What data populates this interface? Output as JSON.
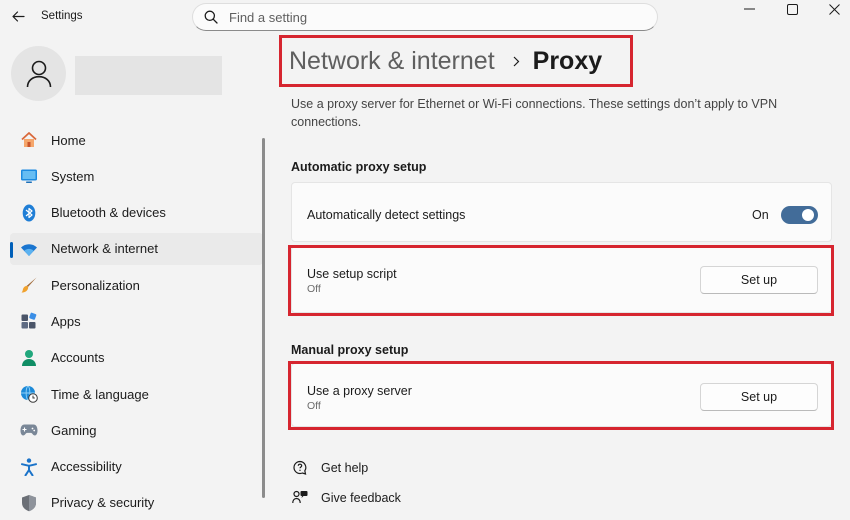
{
  "window": {
    "title": "Settings",
    "minimize_glyph": "—",
    "maximize_glyph": "☐",
    "close_glyph": "✕"
  },
  "search": {
    "placeholder": "Find a setting"
  },
  "sidebar": {
    "items": [
      {
        "label": "Home",
        "icon": "home-icon",
        "active": false
      },
      {
        "label": "System",
        "icon": "system-icon",
        "active": false
      },
      {
        "label": "Bluetooth & devices",
        "icon": "bluetooth-icon",
        "active": false
      },
      {
        "label": "Network & internet",
        "icon": "wifi-icon",
        "active": true
      },
      {
        "label": "Personalization",
        "icon": "brush-icon",
        "active": false
      },
      {
        "label": "Apps",
        "icon": "apps-icon",
        "active": false
      },
      {
        "label": "Accounts",
        "icon": "accounts-icon",
        "active": false
      },
      {
        "label": "Time & language",
        "icon": "globe-clock-icon",
        "active": false
      },
      {
        "label": "Gaming",
        "icon": "gamepad-icon",
        "active": false
      },
      {
        "label": "Accessibility",
        "icon": "accessibility-icon",
        "active": false
      },
      {
        "label": "Privacy & security",
        "icon": "shield-icon",
        "active": false
      }
    ]
  },
  "breadcrumb": {
    "parent": "Network & internet",
    "current": "Proxy"
  },
  "main": {
    "description": "Use a proxy server for Ethernet or Wi-Fi connections. These settings don’t apply to VPN connections.",
    "automatic": {
      "section_title": "Automatic proxy setup",
      "detect": {
        "label": "Automatically detect settings",
        "state": "On"
      },
      "script": {
        "label": "Use setup script",
        "status": "Off",
        "button": "Set up"
      }
    },
    "manual": {
      "section_title": "Manual proxy setup",
      "proxy": {
        "label": "Use a proxy server",
        "status": "Off",
        "button": "Set up"
      }
    },
    "links": {
      "help": "Get help",
      "feedback": "Give feedback"
    }
  },
  "colors": {
    "accent": "#005fb8",
    "toggle_on": "#426c99",
    "highlight_frame": "#d6252f"
  }
}
